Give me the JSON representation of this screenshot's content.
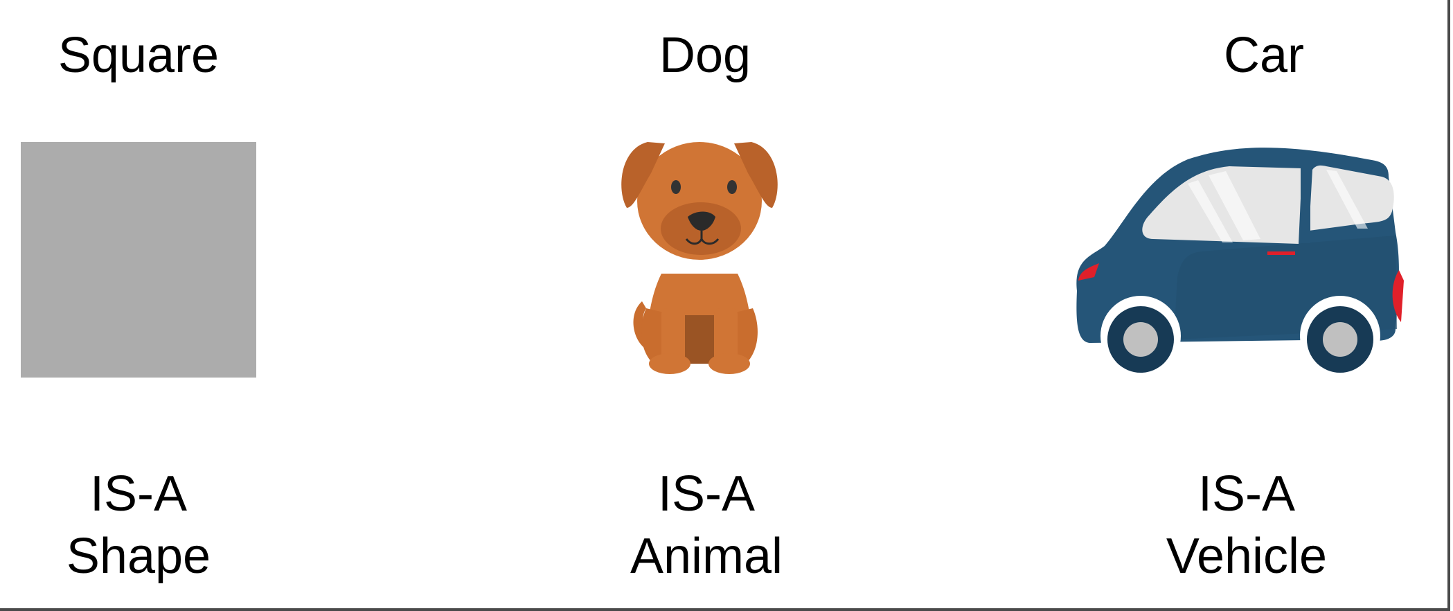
{
  "columns": [
    {
      "id": "square",
      "title": "Square",
      "relation": "IS-A",
      "category": "Shape",
      "fill_color": "#acacac"
    },
    {
      "id": "dog",
      "title": "Dog",
      "relation": "IS-A",
      "category": "Animal",
      "fill_color": "#d07535"
    },
    {
      "id": "car",
      "title": "Car",
      "relation": "IS-A",
      "category": "Vehicle",
      "fill_color": "#255578"
    }
  ],
  "icons": [
    "square-shape",
    "dog-icon",
    "car-icon"
  ]
}
